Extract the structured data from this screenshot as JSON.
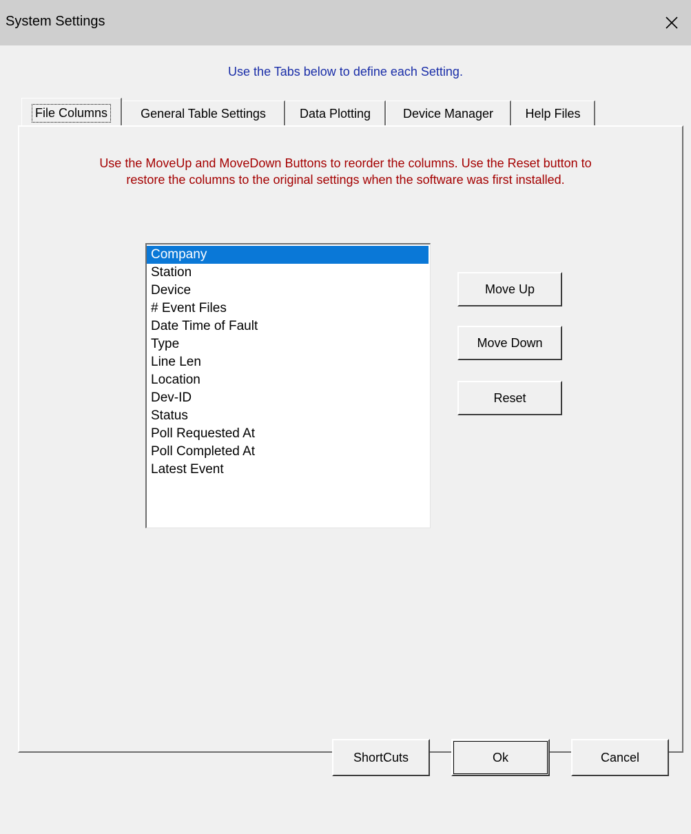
{
  "window": {
    "title": "System Settings",
    "close_icon": "close-icon"
  },
  "instructions": "Use the Tabs below to define each Setting.",
  "tabs": [
    {
      "label": "File Columns",
      "active": true
    },
    {
      "label": "General Table Settings",
      "active": false
    },
    {
      "label": "Data Plotting",
      "active": false
    },
    {
      "label": "Device Manager",
      "active": false
    },
    {
      "label": "Help Files",
      "active": false
    }
  ],
  "panel": {
    "note_line1": "Use the MoveUp and MoveDown Buttons to reorder the columns. Use the Reset button to",
    "note_line2": "restore the columns to the original settings when the software was first installed.",
    "columns": [
      "Company",
      "Station",
      "Device",
      "# Event Files",
      "Date  Time of Fault",
      "Type",
      "Line Len",
      "Location",
      "Dev-ID",
      "Status",
      "Poll Requested At",
      "Poll Completed At",
      "Latest Event"
    ],
    "selected_column": "Company",
    "buttons": {
      "move_up": "Move Up",
      "move_down": "Move Down",
      "reset": "Reset"
    }
  },
  "footer": {
    "shortcuts": "ShortCuts",
    "ok": "Ok",
    "cancel": "Cancel"
  },
  "colors": {
    "selection": "#0a78d7",
    "instructions_text": "#1a2ea8",
    "note_text": "#a40000"
  }
}
